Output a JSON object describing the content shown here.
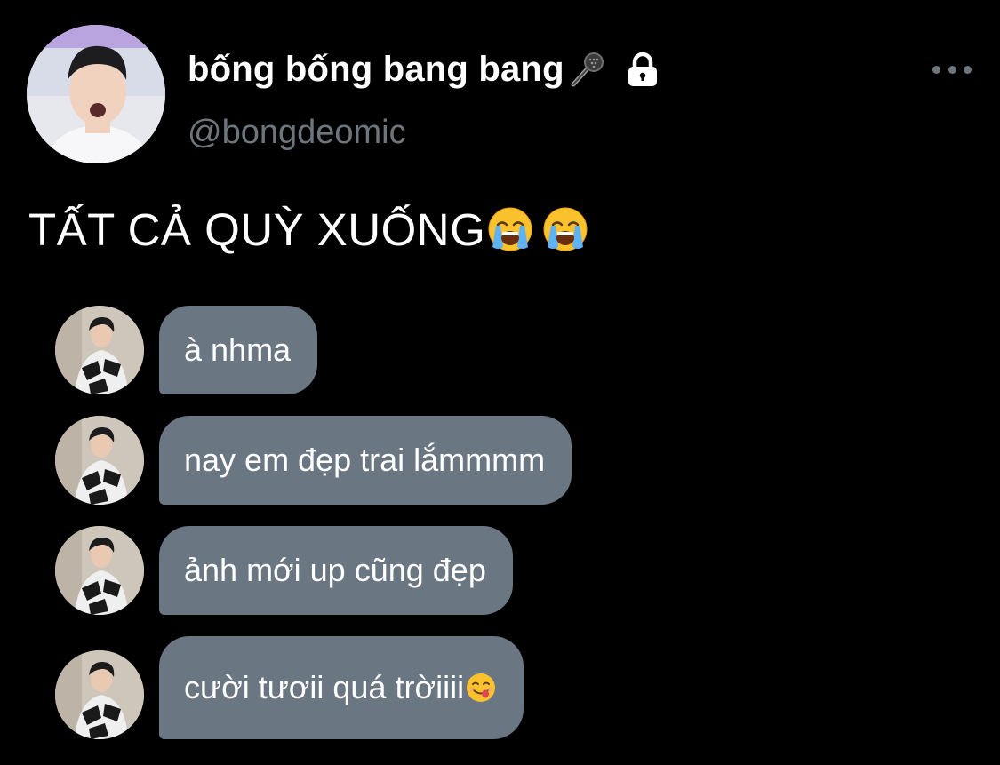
{
  "tweet": {
    "display_name": "bống bống bang bang",
    "name_icons": [
      "microphone-icon",
      "lock-icon"
    ],
    "handle": "@bongdeomic",
    "text": "TẤT CẢ QUỲ XUỐNG",
    "text_emojis": [
      "loudly-crying-face-emoji",
      "loudly-crying-face-emoji"
    ],
    "more_icon": "more-horizontal-icon"
  },
  "messages": [
    {
      "text": "à nhma"
    },
    {
      "text": "nay em đẹp trai lắmmmm"
    },
    {
      "text": "ảnh mới up cũng đẹp"
    },
    {
      "text": "cười tươii quá trờiiii",
      "emoji": "face-savoring-food-emoji"
    }
  ],
  "colors": {
    "background": "#000000",
    "bubble": "#6b7683",
    "handle": "#6e767d",
    "text": "#ffffff"
  }
}
